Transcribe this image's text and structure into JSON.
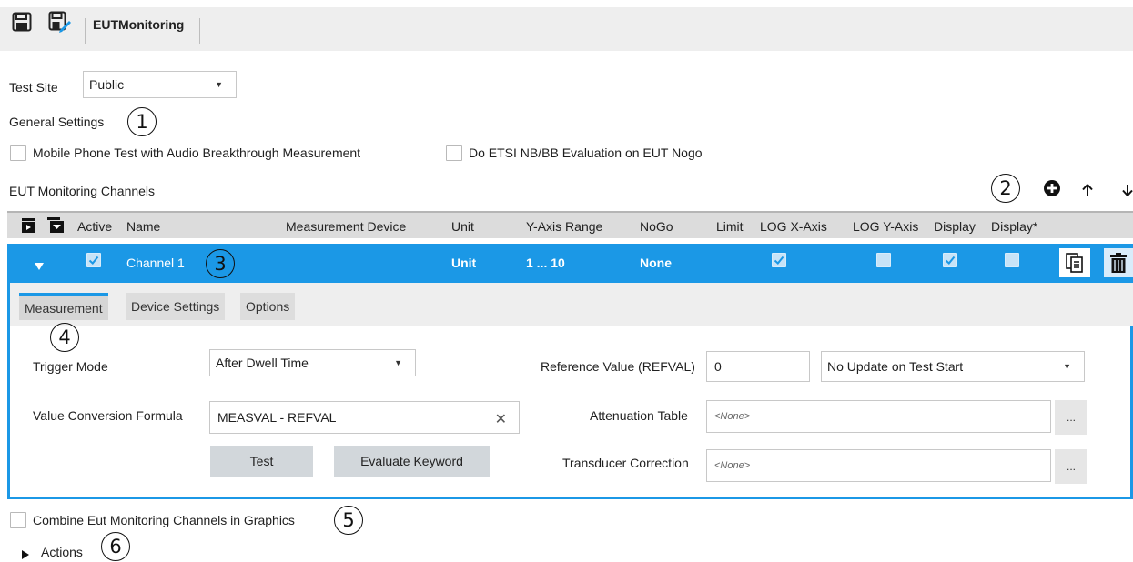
{
  "toolbar": {
    "title": "EUTMonitoring",
    "icons": [
      "save-icon",
      "save-as-icon"
    ]
  },
  "test_site": {
    "label": "Test Site",
    "value": "Public"
  },
  "general_settings": {
    "label": "General Settings",
    "callout": "1",
    "checkboxes": [
      {
        "label": "Mobile Phone Test with Audio Breakthrough Measurement",
        "checked": false
      },
      {
        "label": "Do ETSI NB/BB Evaluation on EUT Nogo",
        "checked": false
      }
    ]
  },
  "channels": {
    "label": "EUT Monitoring Channels",
    "callout": "2",
    "actions": [
      "add-icon",
      "move-up-icon",
      "move-down-icon"
    ],
    "columns": [
      "Active",
      "Name",
      "Measurement Device",
      "Unit",
      "Y-Axis Range",
      "NoGo",
      "Limit",
      "LOG X-Axis",
      "LOG Y-Axis",
      "Display",
      "Display*"
    ],
    "rows": [
      {
        "active": true,
        "name": "Channel 1",
        "callout": "3",
        "device": "",
        "unit": "Unit",
        "y_range": "1 ... 10",
        "nogo": "None",
        "limit": "",
        "log_x": true,
        "log_y": false,
        "display": true,
        "display_star": false
      }
    ]
  },
  "detail": {
    "tabs": [
      "Measurement",
      "Device Settings",
      "Options"
    ],
    "active_tab": "Measurement",
    "tab_callout": "4",
    "trigger_mode": {
      "label": "Trigger Mode",
      "value": "After Dwell Time"
    },
    "formula": {
      "label": "Value Conversion Formula",
      "value": "MEASVAL - REFVAL"
    },
    "test_button": "Test",
    "evaluate_button": "Evaluate Keyword",
    "refval": {
      "label": "Reference Value (REFVAL)",
      "value": "0",
      "mode": "No Update on Test Start"
    },
    "attenuation": {
      "label": "Attenuation Table",
      "value": "<None>"
    },
    "transducer": {
      "label": "Transducer Correction",
      "value": "<None>"
    },
    "browse": "..."
  },
  "combine": {
    "label": "Combine Eut Monitoring Channels in Graphics",
    "callout": "5",
    "checked": false
  },
  "actions": {
    "label": "Actions",
    "callout": "6"
  },
  "colors": {
    "accent": "#1b98e6",
    "header_bg": "#dcdcdc",
    "toolbar_bg": "#eeeeee"
  }
}
